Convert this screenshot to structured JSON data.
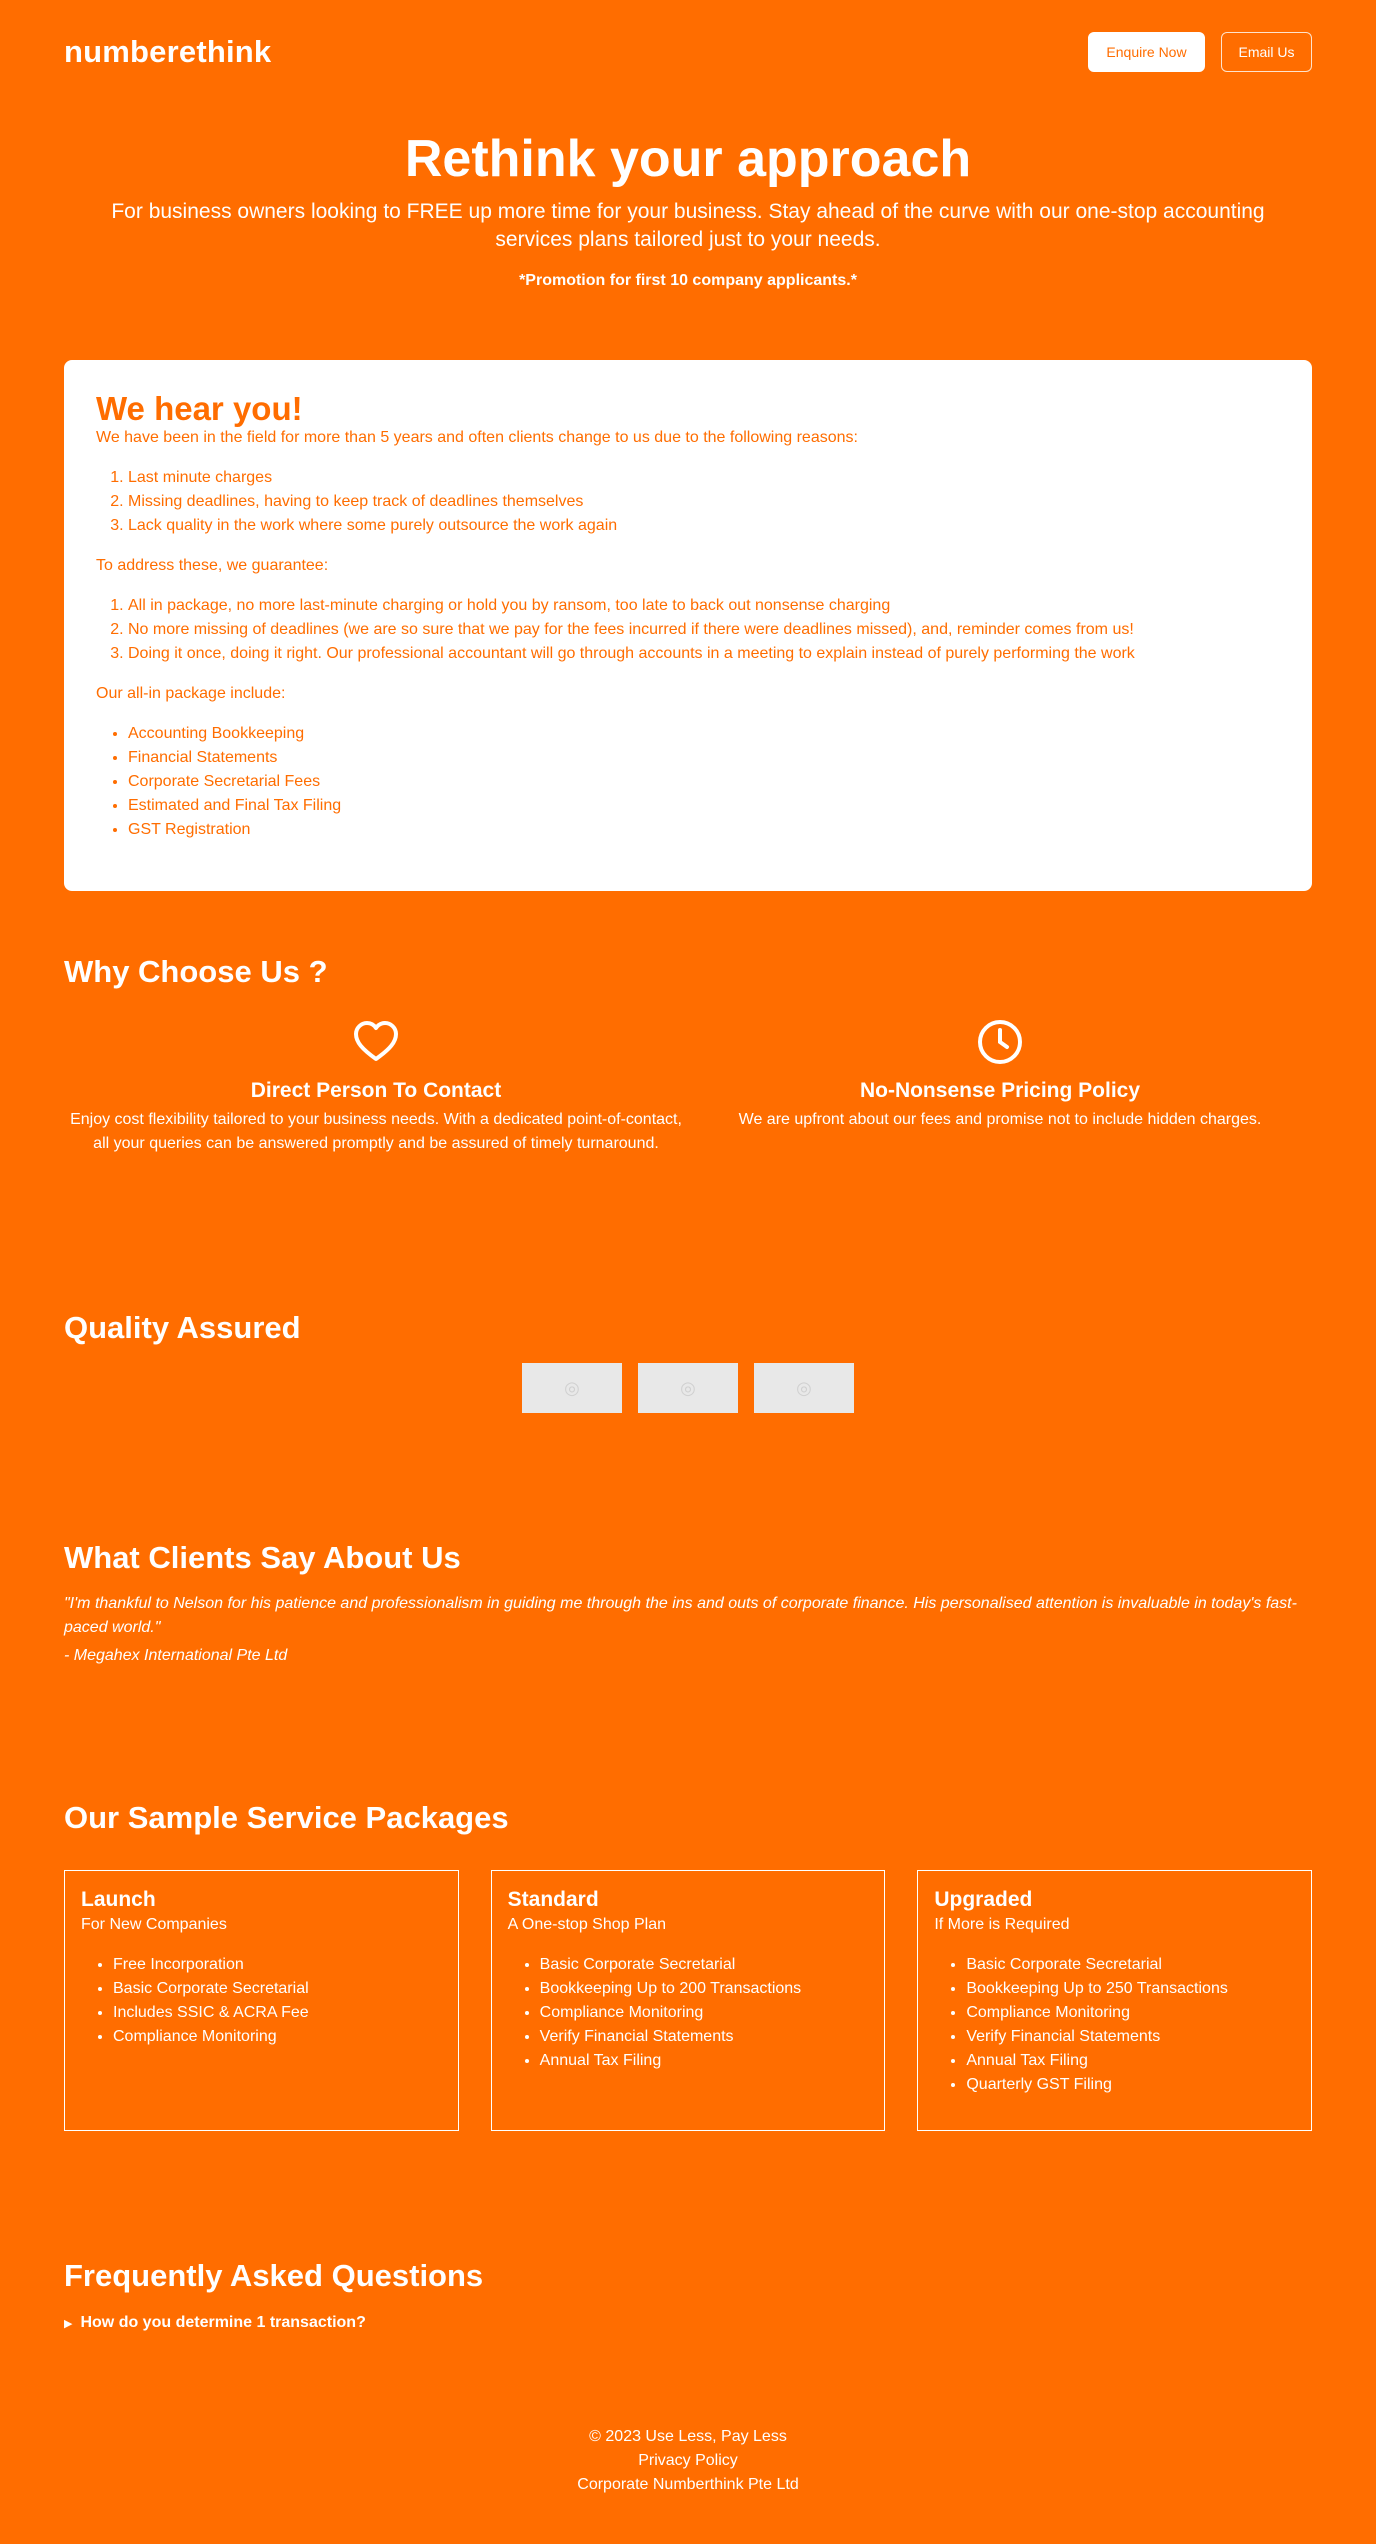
{
  "header": {
    "logo": "numberethink",
    "enquire_label": "Enquire Now",
    "email_label": "Email Us"
  },
  "hero": {
    "title": "Rethink your approach",
    "subtitle": "For business owners looking to FREE up more time for your business. Stay ahead of the curve with our one-stop accounting services plans tailored just to your needs.",
    "promo": "*Promotion for first 10 company applicants.*"
  },
  "hear": {
    "title": "We hear you!",
    "intro": "We have been in the field for more than 5 years and often clients change to us due to the following reasons:",
    "reasons": [
      "Last minute charges",
      "Missing deadlines, having to keep track of deadlines themselves",
      "Lack quality in the work where some purely outsource the work again"
    ],
    "guarantee_intro": "To address these, we guarantee:",
    "guarantees": [
      "All in package, no more last-minute charging or hold you by ransom, too late to back out nonsense charging",
      "No more missing of deadlines (we are so sure that we pay for the fees incurred if there were deadlines missed), and, reminder comes from us!",
      "Doing it once, doing it right. Our professional accountant will go through accounts in a meeting to explain instead of purely performing the work"
    ],
    "package_intro": "Our all-in package include:",
    "package_items": [
      "Accounting Bookkeeping",
      "Financial Statements",
      "Corporate Secretarial Fees",
      "Estimated and Final Tax Filing",
      "GST Registration"
    ]
  },
  "why": {
    "title": "Why Choose Us ?",
    "items": [
      {
        "icon": "heart-icon",
        "title": "Direct Person To Contact",
        "text": "Enjoy cost flexibility tailored to your business needs. With a dedicated point-of-contact, all your queries can be answered promptly and be assured of timely turnaround."
      },
      {
        "icon": "clock-icon",
        "title": "No-Nonsense Pricing Policy",
        "text": "We are upfront about our fees and promise not to include hidden charges."
      }
    ]
  },
  "quality": {
    "title": "Quality Assured",
    "badges": [
      "image-placeholder-icon",
      "image-placeholder-icon",
      "image-placeholder-icon"
    ]
  },
  "testimonials": {
    "title": "What Clients Say About Us",
    "quote": "\"I'm thankful to Nelson for his patience and professionalism in guiding me through the ins and outs of corporate finance. His personalised attention is invaluable in today's fast-paced world.\"",
    "author": "- Megahex International Pte Ltd"
  },
  "packages": {
    "title": "Our Sample Service Packages",
    "items": [
      {
        "name": "Launch",
        "tagline": "For New Companies",
        "features": [
          "Free Incorporation",
          "Basic Corporate Secretarial",
          "Includes SSIC & ACRA Fee",
          "Compliance Monitoring"
        ]
      },
      {
        "name": "Standard",
        "tagline": "A One-stop Shop Plan",
        "features": [
          "Basic Corporate Secretarial",
          "Bookkeeping Up to 200 Transactions",
          "Compliance Monitoring",
          "Verify Financial Statements",
          "Annual Tax Filing"
        ]
      },
      {
        "name": "Upgraded",
        "tagline": "If More is Required",
        "features": [
          "Basic Corporate Secretarial",
          "Bookkeeping Up to 250 Transactions",
          "Compliance Monitoring",
          "Verify Financial Statements",
          "Annual Tax Filing",
          "Quarterly GST Filing"
        ]
      }
    ]
  },
  "faq": {
    "title": "Frequently Asked Questions",
    "items": [
      "How do you determine 1 transaction?"
    ]
  },
  "footer": {
    "copyright": "© 2023 Use Less, Pay Less",
    "privacy": "Privacy Policy",
    "company": "Corporate Numberthink Pte Ltd"
  },
  "colors": {
    "brand_orange": "#ff6d00",
    "white": "#ffffff",
    "placeholder_gray": "#e8e8e8"
  }
}
